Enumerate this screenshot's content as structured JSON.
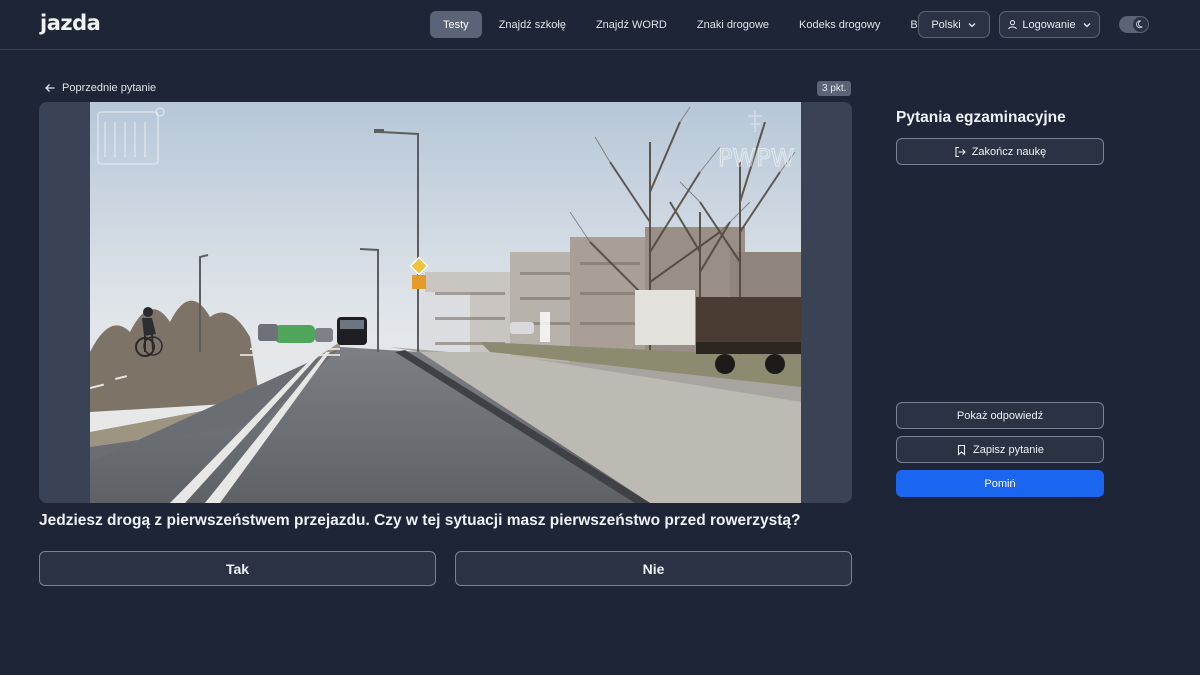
{
  "header": {
    "logo": "jazda",
    "nav": [
      "Testy",
      "Znajdź szkołę",
      "Znajdź WORD",
      "Znaki drogowe",
      "Kodeks drogowy",
      "Blog"
    ],
    "active_nav": "Testy",
    "language": "Polski",
    "login": "Logowanie",
    "theme_icon": "moon-icon"
  },
  "question": {
    "prev_label": "Poprzednie pytanie",
    "points": "3 pkt.",
    "watermark_right": "PWPW",
    "text": "Jedziesz drogą z pierwszeństwem przejazdu. Czy w tej sytuacji masz pierwszeństwo przed rowerzystą?",
    "answers": [
      "Tak",
      "Nie"
    ]
  },
  "sidebar": {
    "title": "Pytania egzaminacyjne",
    "end_label": "Zakończ naukę",
    "show_answer_label": "Pokaż odpowiedź",
    "save_label": "Zapisz pytanie",
    "skip_label": "Pomiń"
  },
  "colors": {
    "background": "#1e2536",
    "primary": "#1a66f0",
    "active_nav": "#5b6476"
  }
}
